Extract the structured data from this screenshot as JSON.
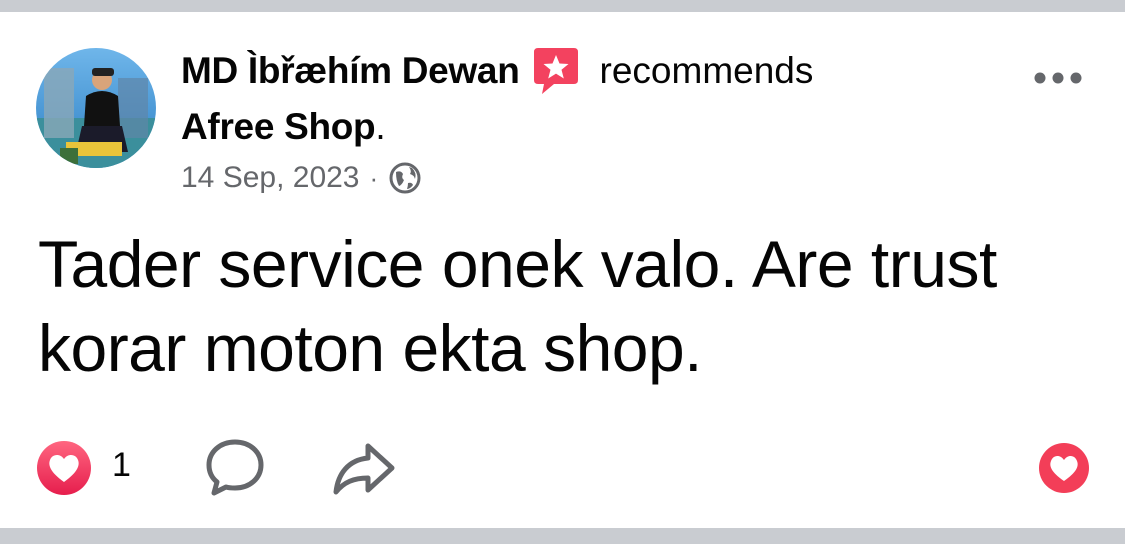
{
  "post": {
    "author_name": "MD Ìbřæhím Dewan",
    "action_text": "recommends",
    "page_name": "Afree Shop",
    "date": "14 Sep, 2023",
    "separator": "·",
    "privacy_icon": "globe-icon",
    "body_text": "Tader service onek valo. Are trust korar moton ekta shop.",
    "reaction_count": "1"
  },
  "colors": {
    "text": "#050505",
    "secondary": "#65676b",
    "recommend_badge": "#f3425f",
    "love_reaction": "#f33e58",
    "divider_band": "#c9ccd1"
  },
  "icons": {
    "recommend": "recommend-star-icon",
    "more": "more-options-icon",
    "reaction": "love-reaction-icon",
    "comment": "comment-icon",
    "share": "share-icon",
    "like": "heart-like-icon"
  }
}
